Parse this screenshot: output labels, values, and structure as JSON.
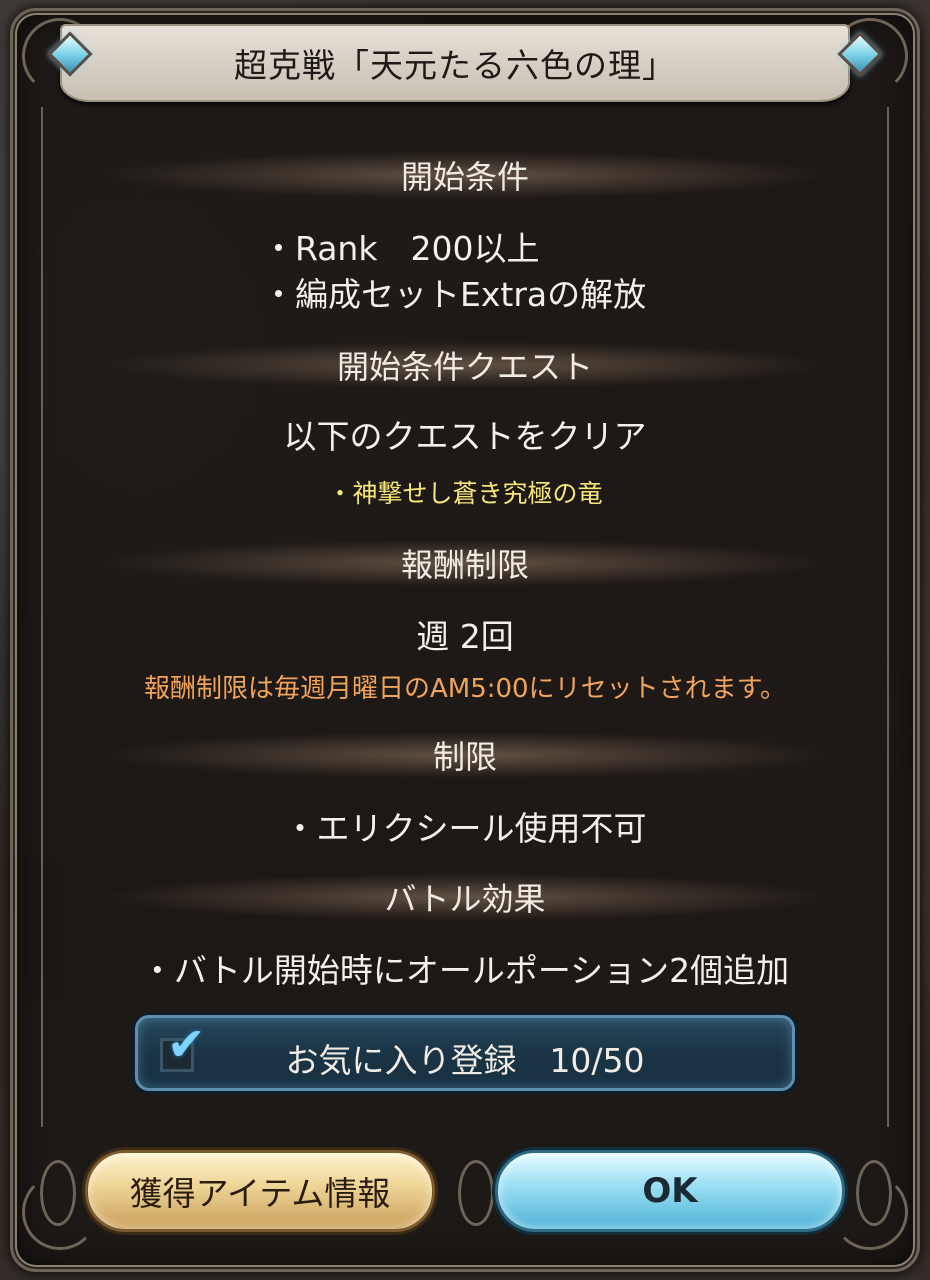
{
  "dialog": {
    "title": "超克戦「天元たる六色の理」"
  },
  "sections": {
    "start_conditions": {
      "heading": "開始条件",
      "items": [
        "・Rank　200以上",
        "・編成セットExtraの解放"
      ]
    },
    "start_quest": {
      "heading": "開始条件クエスト",
      "instruction": "以下のクエストをクリア",
      "quest": "・神撃せし蒼き究極の竜"
    },
    "reward_limit": {
      "heading": "報酬制限",
      "value": "週 2回",
      "note": "報酬制限は毎週月曜日のAM5:00にリセットされます。"
    },
    "restriction": {
      "heading": "制限",
      "item": "・エリクシール使用不可"
    },
    "battle_effect": {
      "heading": "バトル効果",
      "item": "・バトル開始時にオールポーション2個追加"
    }
  },
  "favorite": {
    "checked": true,
    "label": "お気に入り登録　10/50"
  },
  "buttons": {
    "items_info": "獲得アイテム情報",
    "ok": "OK"
  },
  "colors": {
    "quest_highlight": "#f5e57a",
    "note_orange": "#f0a35a"
  }
}
